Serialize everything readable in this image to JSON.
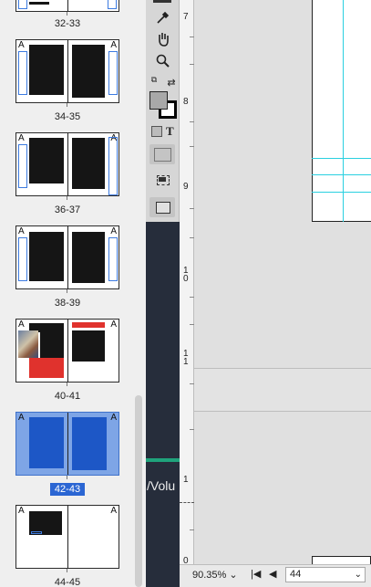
{
  "pages_panel": {
    "spreads": [
      {
        "label": "32-33"
      },
      {
        "label": "34-35",
        "master_left": "A",
        "master_right": "A"
      },
      {
        "label": "36-37",
        "master_left": "A",
        "master_right": "A"
      },
      {
        "label": "38-39",
        "master_left": "A",
        "master_right": "A"
      },
      {
        "label": "40-41",
        "master_left": "A",
        "master_right": "A"
      },
      {
        "label": "42-43",
        "master_left": "A",
        "master_right": "A",
        "selected": true
      },
      {
        "label": "44-45",
        "master_left": "A",
        "master_right": "A"
      }
    ]
  },
  "tools": [
    "eyedropper-icon",
    "hand-icon",
    "zoom-icon",
    "swap-colors-icon",
    "fill-stroke-icon",
    "formatting-text-icon",
    "normal-mode-icon",
    "screen-mode-icon"
  ],
  "tools_text": {
    "formatting_T": "T"
  },
  "ruler": {
    "labels": [
      "7",
      "8",
      "9",
      "1\n0",
      "1\n1",
      "1",
      "0"
    ]
  },
  "overlay_text": "/Volu",
  "status_bar": {
    "zoom": "90.35% ⌄",
    "page_number": "44"
  },
  "colors": {
    "selection": "#2b66d3",
    "guide": "#2ad0e0",
    "accent_green": "#1fa37c"
  }
}
